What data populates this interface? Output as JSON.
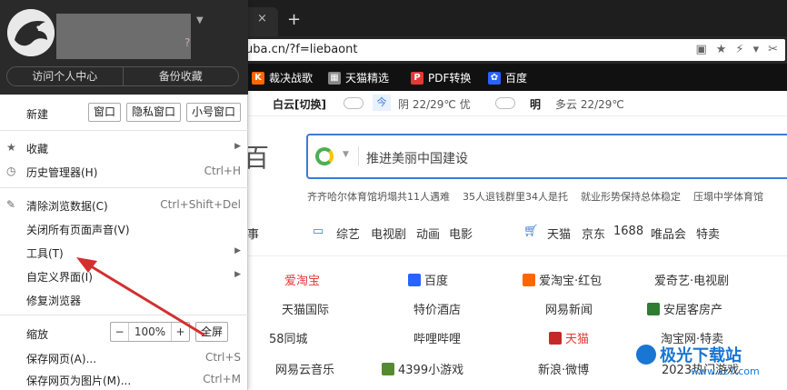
{
  "tabbar": {
    "close_glyph": "×",
    "new_tab_glyph": "+"
  },
  "address": {
    "url": "uba.cn/?f=liebaont",
    "icons": [
      "image-icon",
      "star-icon",
      "lightning-icon",
      "chevron-down-icon",
      "scissors-icon"
    ]
  },
  "bookmarks": [
    {
      "label": "裁决战歌",
      "icon": "K",
      "color": "#ff6600"
    },
    {
      "label": "天猫精选",
      "icon": "▦",
      "color": "#888888"
    },
    {
      "label": "PDF转换",
      "icon": "P",
      "color": "#e53935"
    },
    {
      "label": "百度",
      "icon": "✿",
      "color": "#2962ff"
    }
  ],
  "weather": {
    "location": "白云[切换]",
    "today_badge": "今",
    "today": "阴 22/29℃ 优",
    "tomorrow_label": "明",
    "tomorrow": "多云 22/29℃"
  },
  "search": {
    "left_char": "百",
    "placeholder": "推进美丽中国建设"
  },
  "hot_news": [
    "齐齐哈尔体育馆坍塌共11人遇难",
    "35人退钱群里34人是托",
    "就业形势保持总体稳定",
    "压塌中学体育馆"
  ],
  "categories": [
    "事",
    "综艺",
    "电视剧",
    "动画",
    "电影",
    "天猫",
    "京东",
    "1688",
    "唯品会",
    "特卖"
  ],
  "sites": [
    {
      "label": "爱淘宝",
      "red": true
    },
    {
      "label": "百度",
      "red": false
    },
    {
      "label": "爱淘宝·红包",
      "red": false
    },
    {
      "label": "爱奇艺·电视剧",
      "red": false
    },
    {
      "label": "天猫国际",
      "red": false
    },
    {
      "label": "特价酒店",
      "red": false
    },
    {
      "label": "网易新闻",
      "red": false
    },
    {
      "label": "安居客房产",
      "red": false
    },
    {
      "label": "58同城",
      "red": false
    },
    {
      "label": "哔哩哔哩",
      "red": false
    },
    {
      "label": "天猫",
      "red": true
    },
    {
      "label": "淘宝网·特卖",
      "red": false
    },
    {
      "label": "网易云音乐",
      "red": false
    },
    {
      "label": "4399小游戏",
      "red": false
    },
    {
      "label": "新浪·微博",
      "red": false
    },
    {
      "label": "2023热门游戏",
      "red": false
    }
  ],
  "watermark": {
    "title": "极光下载站",
    "url": "www.xz7.com"
  },
  "menu": {
    "header": {
      "name_suffix": "?",
      "tabs": [
        "访问个人中心",
        "备份收藏"
      ]
    },
    "new_row": {
      "label": "新建",
      "buttons": [
        "窗口",
        "隐私窗口",
        "小号窗口"
      ]
    },
    "items": [
      {
        "label": "收藏",
        "shortcut": "",
        "submenu": true,
        "icon": "star-icon"
      },
      {
        "label": "历史管理器(H)",
        "shortcut": "Ctrl+H",
        "submenu": false,
        "icon": "clock-icon"
      },
      {
        "label": "清除浏览数据(C)",
        "shortcut": "Ctrl+Shift+Del",
        "submenu": false,
        "icon": "broom-icon"
      },
      {
        "label": "关闭所有页面声音(V)",
        "shortcut": "",
        "submenu": false,
        "icon": ""
      },
      {
        "label": "工具(T)",
        "shortcut": "",
        "submenu": true,
        "icon": ""
      },
      {
        "label": "自定义界面(I)",
        "shortcut": "",
        "submenu": true,
        "icon": ""
      },
      {
        "label": "修复浏览器",
        "shortcut": "",
        "submenu": false,
        "icon": ""
      }
    ],
    "zoom": {
      "label": "缩放",
      "minus": "−",
      "value": "100%",
      "plus": "+",
      "fullscreen": "全屏"
    },
    "save_items": [
      {
        "label": "保存网页(A)...",
        "shortcut": "Ctrl+S"
      },
      {
        "label": "保存网页为图片(M)...",
        "shortcut": "Ctrl+M"
      }
    ]
  }
}
